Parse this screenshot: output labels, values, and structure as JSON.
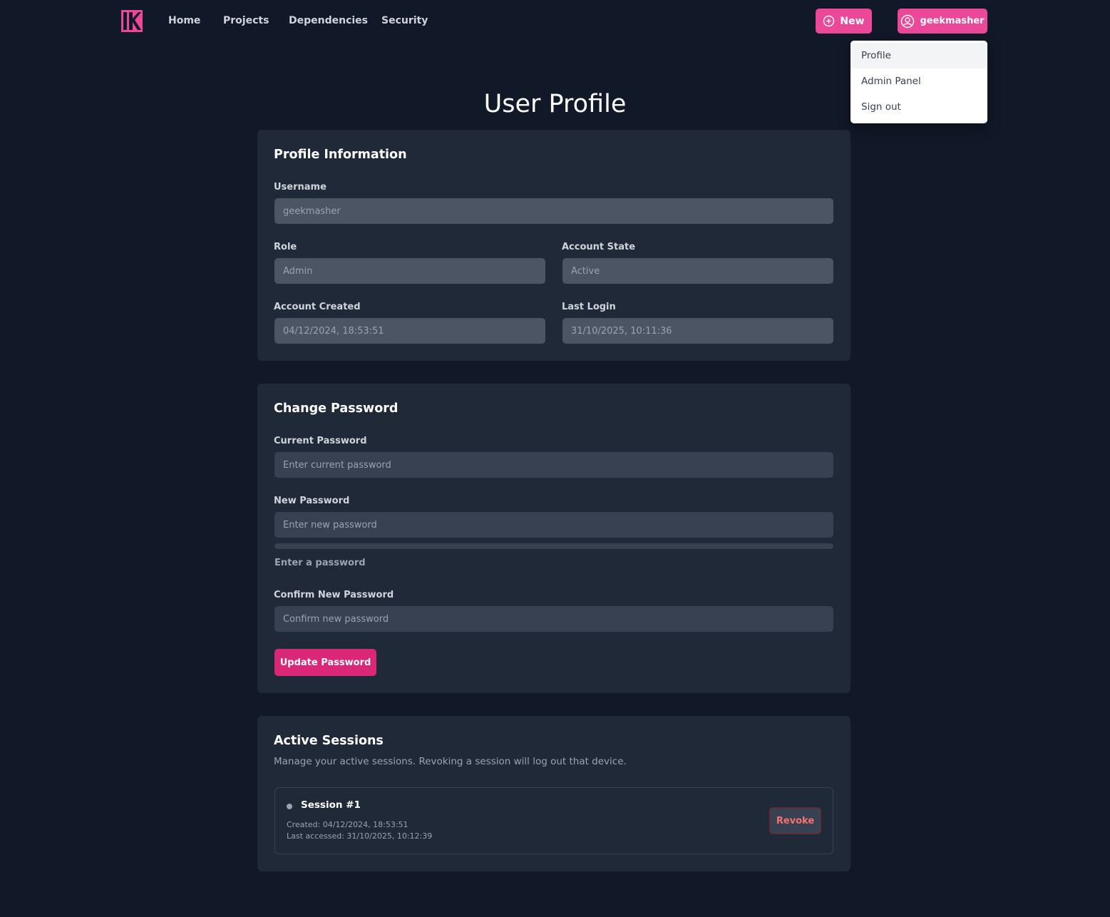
{
  "nav": {
    "links": [
      "Home",
      "Projects",
      "Dependencies",
      "Security"
    ],
    "new_label": "New",
    "user_label": "geekmasher"
  },
  "dropdown": {
    "items": [
      "Profile",
      "Admin Panel",
      "Sign out"
    ]
  },
  "page": {
    "title": "User Profile"
  },
  "profile": {
    "title": "Profile Information",
    "username_label": "Username",
    "username_value": "geekmasher",
    "role_label": "Role",
    "role_value": "Admin",
    "state_label": "Account State",
    "state_value": "Active",
    "created_label": "Account Created",
    "created_value": "04/12/2024, 18:53:51",
    "last_login_label": "Last Login",
    "last_login_value": "31/10/2025, 10:11:36"
  },
  "password": {
    "title": "Change Password",
    "current_label": "Current Password",
    "current_placeholder": "Enter current password",
    "new_label": "New Password",
    "new_placeholder": "Enter new password",
    "strength_hint": "Enter a password",
    "confirm_label": "Confirm New Password",
    "confirm_placeholder": "Confirm new password",
    "submit_label": "Update Password"
  },
  "sessions": {
    "title": "Active Sessions",
    "description": "Manage your active sessions. Revoking a session will log out that device.",
    "items": [
      {
        "name": "Session #1",
        "created": "Created: 04/12/2024, 18:53:51",
        "last_accessed": "Last accessed: 31/10/2025, 10:12:39",
        "revoke_label": "Revoke"
      }
    ]
  },
  "colors": {
    "accent": "#ec4899",
    "background": "#111827",
    "card": "#1f2937"
  }
}
